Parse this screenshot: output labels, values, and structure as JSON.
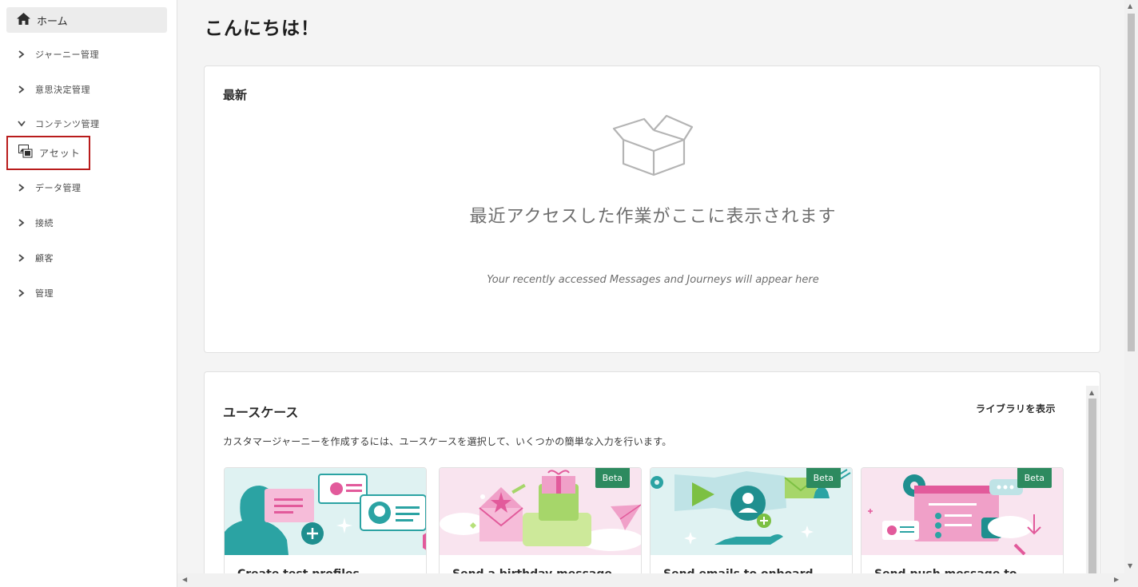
{
  "sidebar": {
    "home_label": "ホーム",
    "items": [
      {
        "label": "ジャーニー管理",
        "state": "collapsed"
      },
      {
        "label": "意思決定管理",
        "state": "collapsed"
      },
      {
        "label": "コンテンツ管理",
        "state": "expanded"
      },
      {
        "label": "アセット",
        "state": "selected"
      },
      {
        "label": "データ管理",
        "state": "collapsed"
      },
      {
        "label": "接続",
        "state": "collapsed"
      },
      {
        "label": "顧客",
        "state": "collapsed"
      },
      {
        "label": "管理",
        "state": "collapsed"
      }
    ]
  },
  "main": {
    "greeting": "こんにちは！",
    "recent": {
      "title": "最新",
      "empty_title": "最近アクセスした作業がここに表示されます",
      "empty_subtitle": "Your recently accessed Messages and Journeys will appear here"
    },
    "use_cases": {
      "title": "ユースケース",
      "view_library": "ライブラリを表示",
      "description": "カスタマージャーニーを作成するには、ユースケースを選択して、いくつかの簡単な入力を行います。",
      "tiles": [
        {
          "title": "Create test profiles",
          "beta": ""
        },
        {
          "title": "Send a birthday message",
          "beta": "Beta"
        },
        {
          "title": "Send emails to onboard",
          "beta": "Beta"
        },
        {
          "title": "Send push message to",
          "beta": "Beta"
        }
      ]
    }
  },
  "colors": {
    "highlight_border": "#b91c1c",
    "beta_badge": "#2d8a5f",
    "teal": "#2ba3a3",
    "pink": "#e25a9b"
  }
}
